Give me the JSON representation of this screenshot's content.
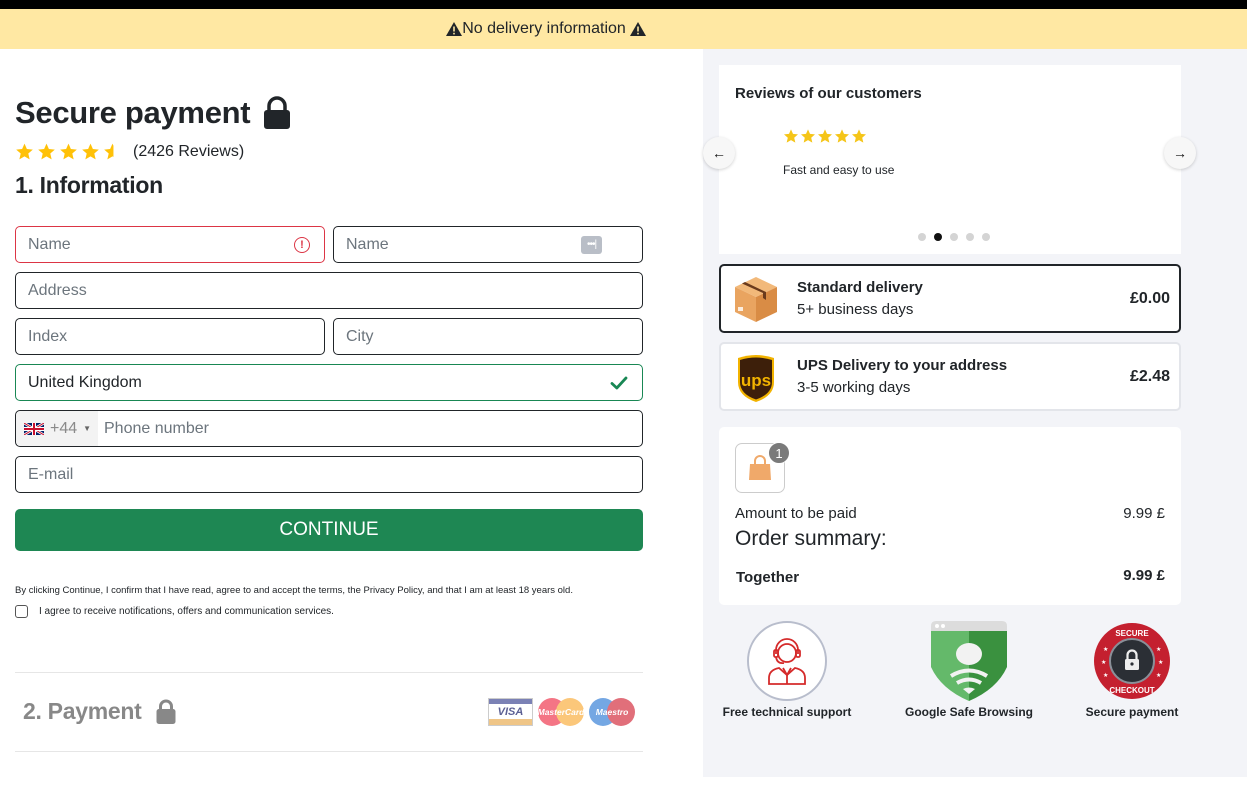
{
  "alert": {
    "text": "No delivery information",
    "icon": "warning-icon"
  },
  "header": {
    "title": "Secure payment",
    "title_icon": "lock-icon",
    "rating": {
      "value": 4.5,
      "max": 5,
      "reviews_label": "(2426 Reviews)"
    }
  },
  "information": {
    "heading": "1. Information",
    "fields": {
      "first_name": {
        "placeholder": "Name",
        "state": "invalid",
        "icon": "error-icon"
      },
      "last_name": {
        "placeholder": "Name",
        "icon": "password-manager-icon",
        "icon_text": "•••|"
      },
      "address": {
        "placeholder": "Address"
      },
      "index": {
        "placeholder": "Index"
      },
      "city": {
        "placeholder": "City"
      },
      "country": {
        "value": "United Kingdom",
        "state": "valid",
        "icon": "check-icon"
      },
      "phone": {
        "country_code": "+44",
        "flag": "uk-flag-icon",
        "placeholder": "Phone number"
      },
      "email": {
        "placeholder": "E-mail"
      }
    },
    "continue_label": "CONTINUE",
    "terms_text": "By clicking Continue, I confirm that I have read, agree to and accept the terms, the Privacy Policy, and that I am at least 18 years old.",
    "notifications_label": "I agree to receive notifications, offers and communication services.",
    "notifications_checked": false
  },
  "payment": {
    "heading": "2. Payment",
    "cards": [
      {
        "name": "visa-icon",
        "label": "VISA"
      },
      {
        "name": "mastercard-icon",
        "label": "MasterCard"
      },
      {
        "name": "maestro-icon",
        "label": "Maestro"
      }
    ]
  },
  "reviews": {
    "title": "Reviews of our customers",
    "current": {
      "stars": 5,
      "text": "Fast and easy to use"
    },
    "slides": 5,
    "active_slide": 2,
    "prev_label": "←",
    "next_label": "→"
  },
  "shipping": [
    {
      "name": "Standard delivery",
      "days": "5+ business days",
      "price": "£0.00",
      "icon": "package-box-icon",
      "selected": true
    },
    {
      "name": "UPS Delivery to your address",
      "days": "3-5 working days",
      "price": "£2.48",
      "icon": "ups-logo-icon",
      "selected": false
    }
  ],
  "summary": {
    "cart_count": "1",
    "amount_label": "Amount to be paid",
    "amount_value": "9.99 £",
    "title": "Order summary:",
    "total_label": "Together",
    "total_value": "9.99 £"
  },
  "trust_badges": [
    {
      "label": "Free technical support",
      "icon": "support-agent-icon"
    },
    {
      "label": "Google Safe Browsing",
      "icon": "google-safe-browsing-icon"
    },
    {
      "label": "Secure payment",
      "icon": "secure-checkout-icon"
    }
  ],
  "colors": {
    "alert_bg": "#ffe8a3",
    "primary_green": "#1e8753",
    "error_red": "#dc3545",
    "valid_green": "#198754",
    "star_yellow": "#ffc107",
    "panel_bg": "#f3f4f8"
  }
}
